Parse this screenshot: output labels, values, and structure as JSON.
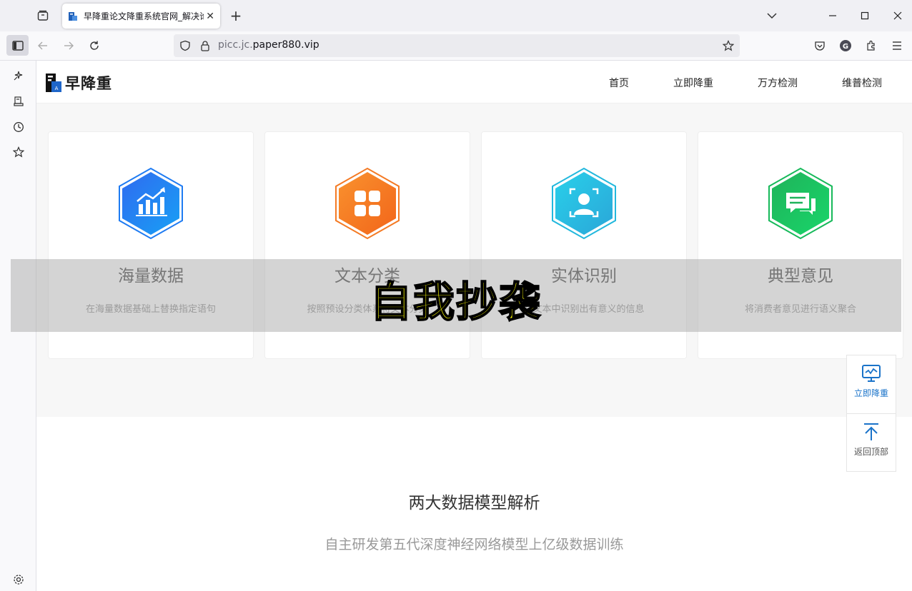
{
  "browser": {
    "tab_title": "早降重论文降重系统官网_解决论文",
    "url_host_dim": "picc.jc.",
    "url_host": "paper880.vip"
  },
  "site": {
    "logo_text": "早降重",
    "nav": [
      "首页",
      "立即降重",
      "万方检测",
      "维普检测"
    ]
  },
  "features": [
    {
      "title": "海量数据",
      "desc": "在海量数据基础上替换指定语句",
      "color": "#1e7bf2",
      "icon": "chart-icon"
    },
    {
      "title": "文本分类",
      "desc": "按照预设分类体系将文本分类",
      "color": "#f47a24",
      "icon": "grid-icon"
    },
    {
      "title": "实体识别",
      "desc": "从文本中识别出有意义的信息",
      "color": "#22b8dd",
      "icon": "face-scan-icon"
    },
    {
      "title": "典型意见",
      "desc": "将消费者意见进行语义聚合",
      "color": "#17b95a",
      "icon": "chat-icon"
    }
  ],
  "overlay_caption": "自我抄袭",
  "section": {
    "title": "两大数据模型解析",
    "subtitle": "自主研发第五代深度神经网络模型上亿级数据训练"
  },
  "float_panel": {
    "reduce_label": "立即降重",
    "top_label": "返回顶部",
    "reduce_color": "#1a73c9",
    "top_color": "#555555"
  }
}
